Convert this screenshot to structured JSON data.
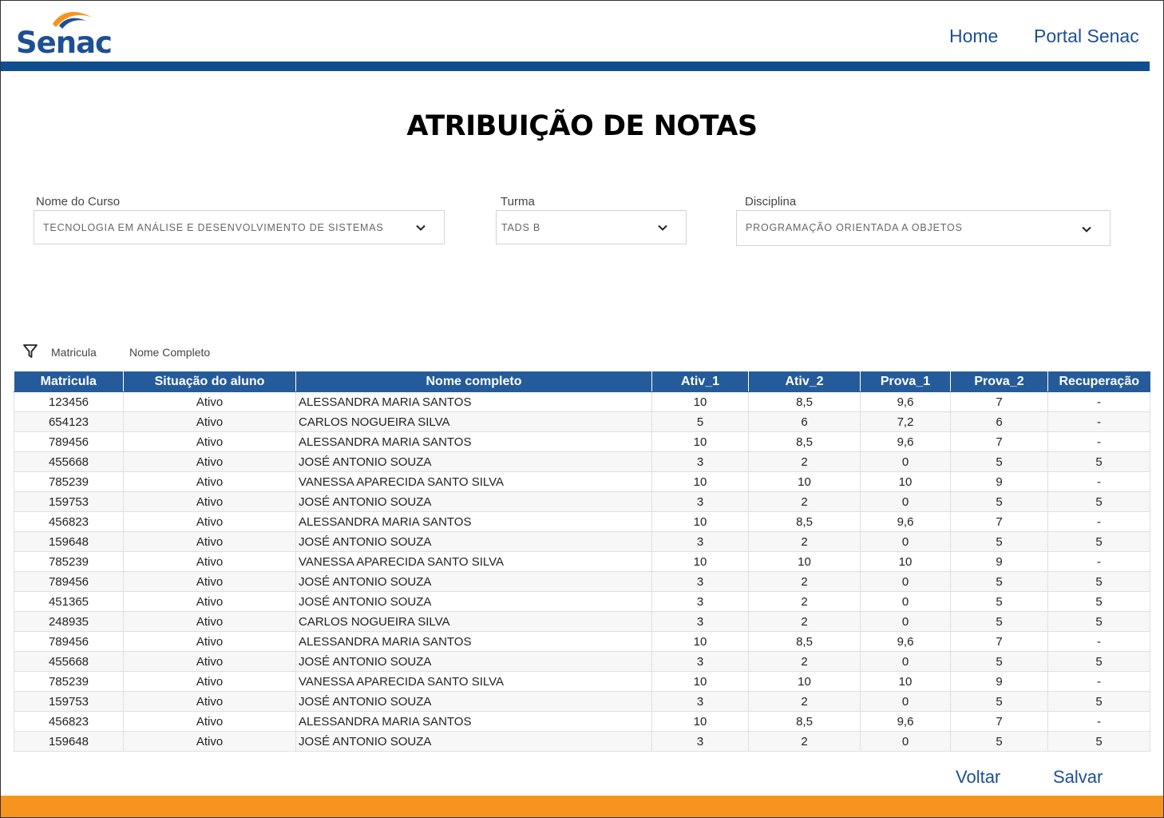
{
  "header": {
    "logo_text": "Senac",
    "nav": [
      "Home",
      "Portal Senac"
    ],
    "colors": {
      "brand_blue": "#1e4f95",
      "bar_blue": "#0f4f8f",
      "accent_orange": "#f7941d"
    }
  },
  "page_title": "ATRIBUIÇÃO DE NOTAS",
  "filters": {
    "curso": {
      "label": "Nome do Curso",
      "value": "TECNOLOGIA EM ANÁLISE E DESENVOLVIMENTO DE SISTEMAS",
      "icon": "chevron-down-icon"
    },
    "turma": {
      "label": "Turma",
      "value": "TADS B",
      "icon": "chevron-down-icon"
    },
    "disciplina": {
      "label": "Disciplina",
      "value": "PROGRAMAÇÃO ORIENTADA A OBJETOS",
      "icon": "chevron-down-icon"
    }
  },
  "filter_bar": {
    "icon": "filter-icon",
    "items": [
      "Matricula",
      "Nome Completo"
    ]
  },
  "table": {
    "columns": [
      "Matricula",
      "Situação do aluno",
      "Nome completo",
      "Ativ_1",
      "Ativ_2",
      "Prova_1",
      "Prova_2",
      "Recuperação"
    ],
    "rows": [
      [
        "123456",
        "Ativo",
        "ALESSANDRA MARIA SANTOS",
        "10",
        "8,5",
        "9,6",
        "7",
        "-"
      ],
      [
        "654123",
        "Ativo",
        "CARLOS NOGUEIRA SILVA",
        "5",
        "6",
        "7,2",
        "6",
        "-"
      ],
      [
        "789456",
        "Ativo",
        "ALESSANDRA MARIA SANTOS",
        "10",
        "8,5",
        "9,6",
        "7",
        "-"
      ],
      [
        "455668",
        "Ativo",
        "JOSÉ ANTONIO SOUZA",
        "3",
        "2",
        "0",
        "5",
        "5"
      ],
      [
        "785239",
        "Ativo",
        "VANESSA APARECIDA SANTO SILVA",
        "10",
        "10",
        "10",
        "9",
        "-"
      ],
      [
        "159753",
        "Ativo",
        "JOSÉ ANTONIO SOUZA",
        "3",
        "2",
        "0",
        "5",
        "5"
      ],
      [
        "456823",
        "Ativo",
        "ALESSANDRA MARIA SANTOS",
        "10",
        "8,5",
        "9,6",
        "7",
        "-"
      ],
      [
        "159648",
        "Ativo",
        "JOSÉ ANTONIO SOUZA",
        "3",
        "2",
        "0",
        "5",
        "5"
      ],
      [
        "785239",
        "Ativo",
        "VANESSA APARECIDA SANTO SILVA",
        "10",
        "10",
        "10",
        "9",
        "-"
      ],
      [
        "789456",
        "Ativo",
        "JOSÉ ANTONIO SOUZA",
        "3",
        "2",
        "0",
        "5",
        "5"
      ],
      [
        "451365",
        "Ativo",
        "JOSÉ ANTONIO SOUZA",
        "3",
        "2",
        "0",
        "5",
        "5"
      ],
      [
        "248935",
        "Ativo",
        "CARLOS NOGUEIRA SILVA",
        "3",
        "2",
        "0",
        "5",
        "5"
      ],
      [
        "789456",
        "Ativo",
        "ALESSANDRA MARIA SANTOS",
        "10",
        "8,5",
        "9,6",
        "7",
        "-"
      ],
      [
        "455668",
        "Ativo",
        "JOSÉ ANTONIO SOUZA",
        "3",
        "2",
        "0",
        "5",
        "5"
      ],
      [
        "785239",
        "Ativo",
        "VANESSA APARECIDA SANTO SILVA",
        "10",
        "10",
        "10",
        "9",
        "-"
      ],
      [
        "159753",
        "Ativo",
        "JOSÉ ANTONIO SOUZA",
        "3",
        "2",
        "0",
        "5",
        "5"
      ],
      [
        "456823",
        "Ativo",
        "ALESSANDRA MARIA SANTOS",
        "10",
        "8,5",
        "9,6",
        "7",
        "-"
      ],
      [
        "159648",
        "Ativo",
        "JOSÉ ANTONIO SOUZA",
        "3",
        "2",
        "0",
        "5",
        "5"
      ]
    ]
  },
  "actions": {
    "back": "Voltar",
    "save": "Salvar"
  }
}
